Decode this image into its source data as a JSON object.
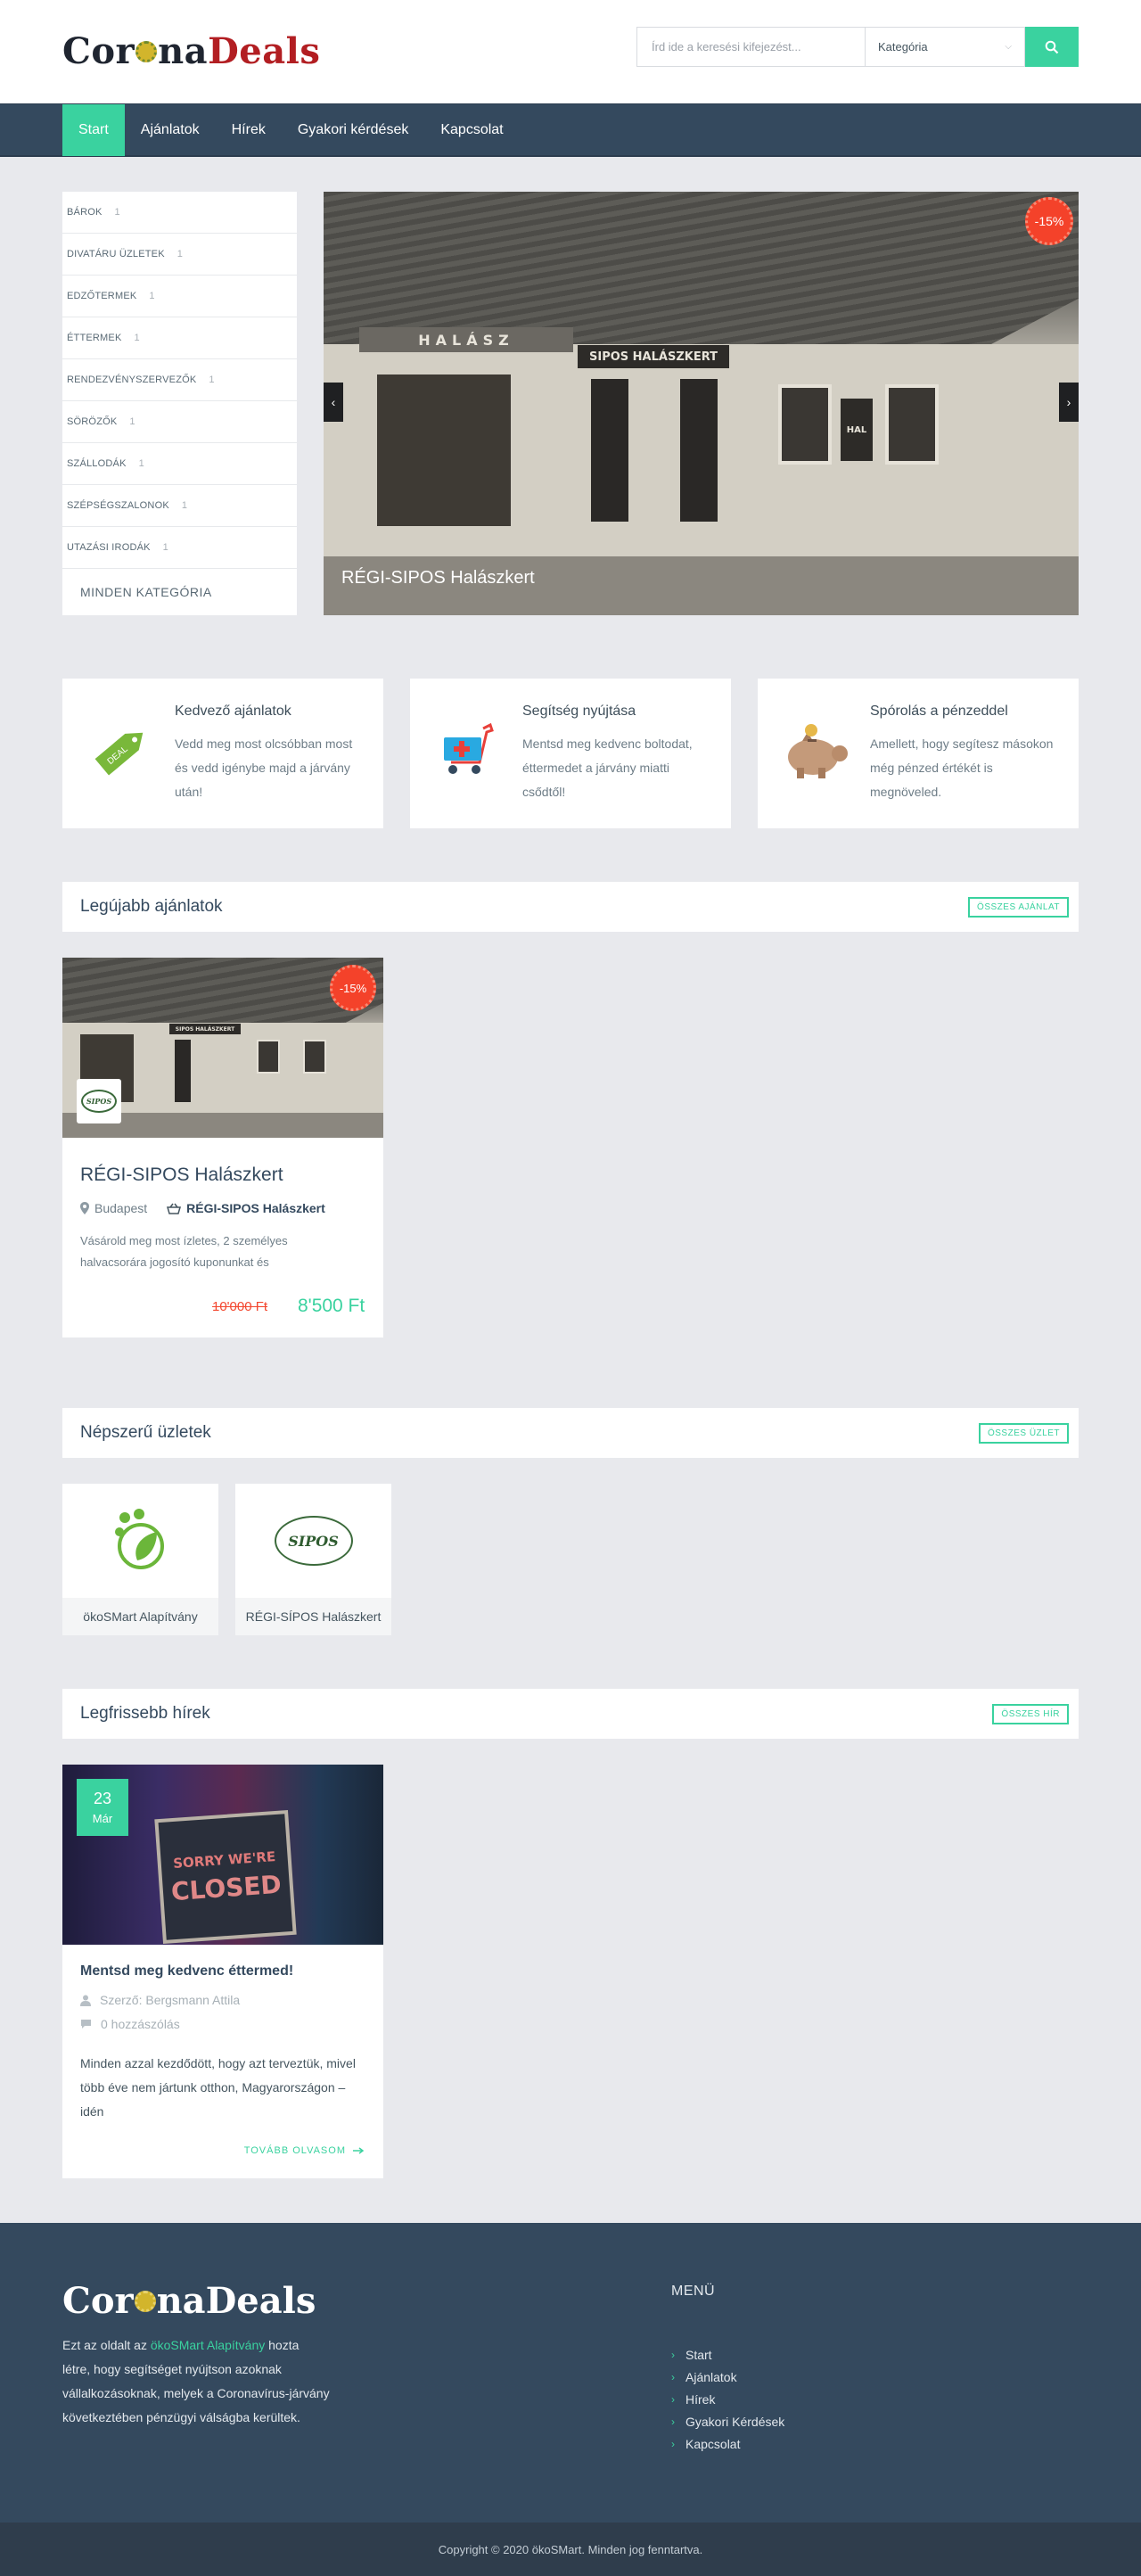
{
  "brand": {
    "part1": "CoronaDeals",
    "p1a": "Cor",
    "p1b": "na",
    "p2": "Deals"
  },
  "search": {
    "placeholder": "Írd ide a keresési kifejezést...",
    "category": "Kategória"
  },
  "nav": [
    "Start",
    "Ajánlatok",
    "Hírek",
    "Gyakori kérdések",
    "Kapcsolat"
  ],
  "categories": [
    {
      "label": "Bárok",
      "count": "1"
    },
    {
      "label": "Divatáru üzletek",
      "count": "1"
    },
    {
      "label": "Edzőtermek",
      "count": "1"
    },
    {
      "label": "Éttermek",
      "count": "1"
    },
    {
      "label": "Rendezvényszervezők",
      "count": "1"
    },
    {
      "label": "Sörözők",
      "count": "1"
    },
    {
      "label": "Szállodák",
      "count": "1"
    },
    {
      "label": "Szépségszalonok",
      "count": "1"
    },
    {
      "label": "Utazási irodák",
      "count": "1"
    }
  ],
  "all_categories": "MINDEN KATEGÓRIA",
  "slider": {
    "badge": "-15%",
    "caption": "RÉGI-SIPOS Halászkert",
    "sign": "SIPOS HALÁSZKERT",
    "roof_sign": "HALÁSZ",
    "hal_sign": "HAL",
    "prev": "‹",
    "next": "›"
  },
  "features": [
    {
      "title": "Kedvező ajánlatok",
      "text": "Vedd meg most olcsóbban most és vedd igénybe majd a járvány után!",
      "tag": "DEAL"
    },
    {
      "title": "Segítség nyújtása",
      "text": "Mentsd meg kedvenc boltodat, éttermedet a járvány miatti csődtől!"
    },
    {
      "title": "Spórolás a pénzeddel",
      "text": "Amellett, hogy segítesz másokon még pénzed értékét is megnöveled."
    }
  ],
  "latest_deals": {
    "title": "Legújabb ajánlatok",
    "more": "ÖSSZES AJÁNLAT",
    "card": {
      "badge": "-15%",
      "title": "RÉGI-SIPOS Halászkert",
      "city": "Budapest",
      "shop": "RÉGI-SIPOS Halászkert",
      "desc": "Vásárold meg most ízletes, 2 személyes halvacsorára jogosító kuponunkat és",
      "old_price": "10'000 Ft",
      "new_price": "8'500 Ft",
      "logo": "SIPOS",
      "sign": "SIPOS HALÁSZKERT"
    }
  },
  "popular_shops": {
    "title": "Népszerű üzletek",
    "more": "ÖSSZES ÜZLET",
    "shops": [
      {
        "name": "ökoSMart Alapítvány"
      },
      {
        "name": "RÉGI-SÍPOS Halászkert",
        "logo": "SIPOS"
      }
    ]
  },
  "news": {
    "title": "Legfrissebb hírek",
    "more": "ÖSSZES HÍR",
    "card": {
      "day": "23",
      "month": "Már",
      "sign1": "SORRY WE'RE",
      "sign2": "CLOSED",
      "title": "Mentsd meg kedvenc éttermed!",
      "author": "Szerző: Bergsmann Attila",
      "comments": "0 hozzászólás",
      "text": "Minden azzal kezdődött, hogy azt terveztük, mivel több éve nem jártunk otthon, Magyarországon – idén",
      "read_more": "TOVÁBB OLVASOM"
    }
  },
  "footer": {
    "about_before": "Ezt az oldalt az",
    "about_link": "ökoSMart Alapítvány",
    "about_after": "hozta létre, hogy segítséget nyújtson azoknak vállalkozásoknak, melyek a Coronavírus-járvány következtében pénzügyi válságba kerültek.",
    "menu_title": "MENÜ",
    "menu": [
      "Start",
      "Ajánlatok",
      "Hírek",
      "Gyakori Kérdések",
      "Kapcsolat"
    ],
    "copyright": "Copyright © 2020 ökoSMart. Minden jog fenntartva."
  },
  "colors": {
    "accent": "#3ad29f",
    "nav_bg": "#34495e",
    "badge": "#f4422a",
    "brand_red": "#b21e22"
  }
}
